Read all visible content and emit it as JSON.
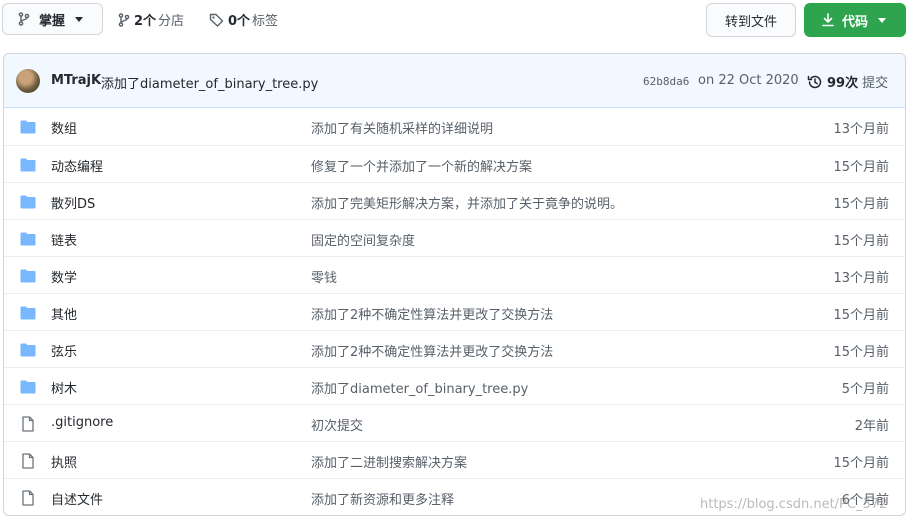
{
  "toolbar": {
    "branch_label": "掌握",
    "branches_count": "2个",
    "branches_label": "分店",
    "tags_count": "0个",
    "tags_label": "标签",
    "goto_file_label": "转到文件",
    "code_label": "代码"
  },
  "commit": {
    "author": "MTrajK",
    "message": "添加了diameter_of_binary_tree.py",
    "sha": "62b8da6",
    "date": "on 22 Oct 2020",
    "count": "99次",
    "count_label": "提交"
  },
  "files": [
    {
      "type": "folder",
      "name": "数组",
      "message": "添加了有关随机采样的详细说明",
      "age": "13个月前"
    },
    {
      "type": "folder",
      "name": "动态编程",
      "message": "修复了一个并添加了一个新的解决方案",
      "age": "15个月前"
    },
    {
      "type": "folder",
      "name": "散列DS",
      "message": "添加了完美矩形解决方案，并添加了关于竟争的说明。",
      "age": "15个月前"
    },
    {
      "type": "folder",
      "name": "链表",
      "message": "固定的空间复杂度",
      "age": "15个月前"
    },
    {
      "type": "folder",
      "name": "数学",
      "message": "零钱",
      "age": "13个月前"
    },
    {
      "type": "folder",
      "name": "其他",
      "message": "添加了2种不确定性算法并更改了交换方法",
      "age": "15个月前"
    },
    {
      "type": "folder",
      "name": "弦乐",
      "message": "添加了2种不确定性算法并更改了交换方法",
      "age": "15个月前"
    },
    {
      "type": "folder",
      "name": "树木",
      "message": "添加了diameter_of_binary_tree.py",
      "age": "5个月前"
    },
    {
      "type": "file",
      "name": ".gitignore",
      "message": "初次提交",
      "age": "2年前"
    },
    {
      "type": "file",
      "name": "执照",
      "message": "添加了二进制搜索解决方案",
      "age": "15个月前"
    },
    {
      "type": "file",
      "name": "自述文件",
      "message": "添加了新资源和更多注释",
      "age": "6个月前"
    }
  ],
  "watermark": "https://blog.csdn.net/PC_372",
  "colors": {
    "folder": "#79b8ff",
    "file": "#6a737d",
    "code_button": "#2ea44f",
    "commit_bg": "#f1f8ff"
  }
}
